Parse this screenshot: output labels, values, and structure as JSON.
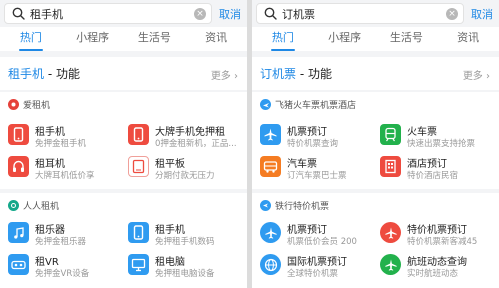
{
  "left": {
    "search": {
      "query": "租手机"
    },
    "cancel_label": "取消",
    "tabs": [
      {
        "label": "热门"
      },
      {
        "label": "小程序"
      },
      {
        "label": "生活号"
      },
      {
        "label": "资讯"
      }
    ],
    "section": {
      "keyword": "租手机",
      "suffix": " - 功能",
      "more_label": "更多"
    },
    "cards": [
      {
        "brand": "爱租机",
        "items": [
          {
            "name": "租手机",
            "desc": "免押金租手机"
          },
          {
            "name": "大牌手机免押租",
            "desc": "0押金租新机，正品..."
          },
          {
            "name": "租耳机",
            "desc": "大牌耳机低价享"
          },
          {
            "name": "租平板",
            "desc": "分期付款无压力"
          }
        ]
      },
      {
        "brand": "人人租机",
        "items": [
          {
            "name": "租乐器",
            "desc": "免押金租乐器"
          },
          {
            "name": "租手机",
            "desc": "免押租手机数码"
          },
          {
            "name": "租VR",
            "desc": "免押金VR设备"
          },
          {
            "name": "租电脑",
            "desc": "免押租电脑设备"
          }
        ]
      }
    ]
  },
  "right": {
    "search": {
      "query": "订机票"
    },
    "cancel_label": "取消",
    "tabs": [
      {
        "label": "热门"
      },
      {
        "label": "小程序"
      },
      {
        "label": "生活号"
      },
      {
        "label": "资讯"
      }
    ],
    "section": {
      "keyword": "订机票",
      "suffix": " - 功能",
      "more_label": "更多"
    },
    "cards": [
      {
        "brand": "飞猪火车票机票酒店",
        "items": [
          {
            "name": "机票预订",
            "desc": "特价机票查询"
          },
          {
            "name": "火车票",
            "desc": "快速出票支持抢票"
          },
          {
            "name": "汽车票",
            "desc": "订汽车票巴士票"
          },
          {
            "name": "酒店预订",
            "desc": "特价酒店民宿"
          }
        ]
      },
      {
        "brand": "铁行特价机票",
        "items": [
          {
            "name": "机票预订",
            "desc": "机票低价会员 200"
          },
          {
            "name": "特价机票预订",
            "desc": "特价机票新客减45"
          },
          {
            "name": "国际机票预订",
            "desc": "全球特价机票"
          },
          {
            "name": "航班动态查询",
            "desc": "实时航班动态"
          }
        ]
      }
    ]
  },
  "colors": {
    "accent": "#1e88e5",
    "red": "#ee4b3f",
    "orange": "#f57c22",
    "blue": "#2f9bf0",
    "green": "#22b14c",
    "teal": "#14a88a"
  },
  "icons": {
    "left_brand1": "aizuji-logo-icon",
    "left_brand2": "renrenzuji-logo-icon",
    "right_brand1": "fliggy-plane-icon",
    "right_brand2": "tiehang-logo-icon"
  }
}
